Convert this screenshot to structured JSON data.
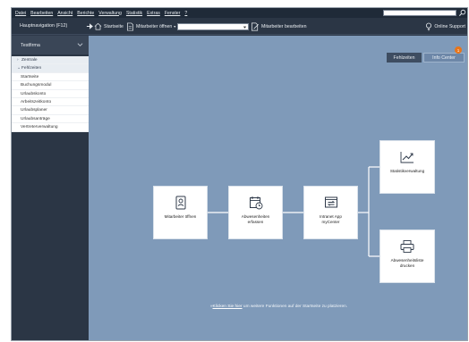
{
  "menu": [
    "Datei",
    "Bearbeiten",
    "Ansicht",
    "Berichte",
    "Verwaltung",
    "Statistik",
    "Extras",
    "Fenster",
    "?"
  ],
  "toolbar": {
    "nav_label": "Hauptnavigation (F12)",
    "start_label": "Startseite",
    "open_label": "Mitarbeiter öffnen",
    "combo_value": "",
    "edit_label": "Mitarbeiter bearbeiten",
    "support_label": "Online Support"
  },
  "sidebar": {
    "company": "Testfirma",
    "items": [
      {
        "label": "Zentrale",
        "type": "group",
        "arrow": "›"
      },
      {
        "label": "Fehlzeiten",
        "type": "group",
        "arrow": "⌄"
      },
      {
        "label": "Startseite",
        "type": "item"
      },
      {
        "label": "Buchungsmodul",
        "type": "item"
      },
      {
        "label": "Urlaubskonto",
        "type": "item"
      },
      {
        "label": "Arbeitszeitkonto",
        "type": "item"
      },
      {
        "label": "Urlaubsplaner",
        "type": "item"
      },
      {
        "label": "Urlaubsanträge",
        "type": "item"
      },
      {
        "label": "Vertreterverwaltung",
        "type": "item"
      }
    ]
  },
  "tabs": {
    "fehlzeiten": "Fehlzeiten",
    "info": "Info Center",
    "info_badge": "1"
  },
  "cards": {
    "mitarbeiter": "Mitarbeiter öffnen",
    "abwesenheiten_1": "Abwesenheiten",
    "abwesenheiten_2": "erfassen",
    "intranet_1": "Intranet App",
    "intranet_2": "myCenter",
    "statistik": "Statistikverwaltung",
    "druck_1": "Abwesenheitsliste",
    "druck_2": "drucken"
  },
  "hint": {
    "prefix": "»",
    "link": "Klicken Sie hier",
    "rest": " um weitere Funktionen auf der Startseite zu platzieren."
  },
  "colors": {
    "content_bg": "#7f9ab9",
    "dark_panel": "#2b3645",
    "accent_orange": "#e8751a"
  }
}
